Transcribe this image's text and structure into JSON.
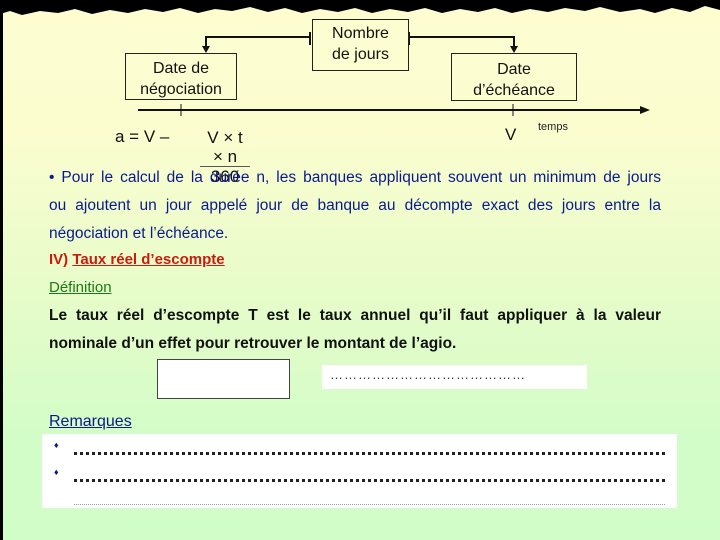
{
  "diagram": {
    "box_negociation": [
      "Date de",
      "négociation"
    ],
    "box_nombre_jours": [
      "Nombre",
      "de jours"
    ],
    "box_echeance": [
      "Date",
      "d’échéance"
    ],
    "timeline_label": "temps",
    "v_label": "V"
  },
  "formula": {
    "lhs": "a = V –",
    "numerator": "V × t × n",
    "denominator": "360"
  },
  "paragraph": {
    "bullet": "•",
    "lines": [
      "• Pour le calcul de la durée n, les banques appliquent souvent un minimum de jours",
      "ou ajoutent un jour appelé jour de banque au décompte exact des jours entre la",
      "négociation et l’échéance."
    ]
  },
  "section": {
    "number": "IV)",
    "title": "Taux réel d’escompte"
  },
  "definition": {
    "label": "Définition",
    "lines": [
      "Le taux réel d’escompte T est le taux annuel qu’il faut appliquer à la valeur",
      "nominale d’un effet pour retrouver le montant de l’agio."
    ]
  },
  "answer_field": {
    "value": "……………………………………"
  },
  "remarques": {
    "label": "Remarques",
    "bullet": "♦",
    "rows": 2
  },
  "colors": {
    "body_text": "#0a1a8c",
    "heading_red": "#cc1a0c",
    "definition_green": "#1a7a14"
  }
}
